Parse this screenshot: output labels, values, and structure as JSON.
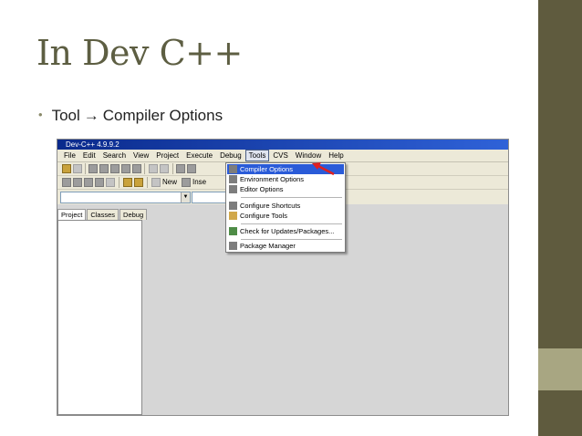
{
  "slide": {
    "title": "In Dev C++",
    "bullet_prefix": "Tool",
    "bullet_arrow": "→",
    "bullet_suffix": "Compiler Options"
  },
  "app": {
    "window_title": "Dev-C++ 4.9.9.2",
    "menu": [
      "File",
      "Edit",
      "Search",
      "View",
      "Project",
      "Execute",
      "Debug",
      "Tools",
      "CVS",
      "Window",
      "Help"
    ],
    "active_menu": "Tools",
    "toolbar2": {
      "new_label": "New",
      "insert_label": "Inse"
    },
    "panel_tabs": [
      "Project",
      "Classes",
      "Debug"
    ],
    "combo_arrow": "▼",
    "tools_menu": [
      {
        "label": "Compiler Options",
        "icon": "compiler-options-icon",
        "highlighted": true
      },
      {
        "label": "Environment Options",
        "icon": "environment-options-icon"
      },
      {
        "label": "Editor Options",
        "icon": "editor-options-icon"
      },
      {
        "label": "Configure Shortcuts",
        "icon": "configure-shortcuts-icon"
      },
      {
        "label": "Configure Tools",
        "icon": "configure-tools-icon"
      },
      {
        "label": "Check for Updates/Packages...",
        "icon": "check-updates-icon"
      },
      {
        "label": "Package Manager",
        "icon": "package-manager-icon"
      }
    ]
  },
  "colors": {
    "title": "#5d5e42",
    "side_bar": "#5f5b3e",
    "side_band": "#a8a682",
    "menu_highlight": "#2a5bd8",
    "annotation_arrow": "#e02020"
  }
}
